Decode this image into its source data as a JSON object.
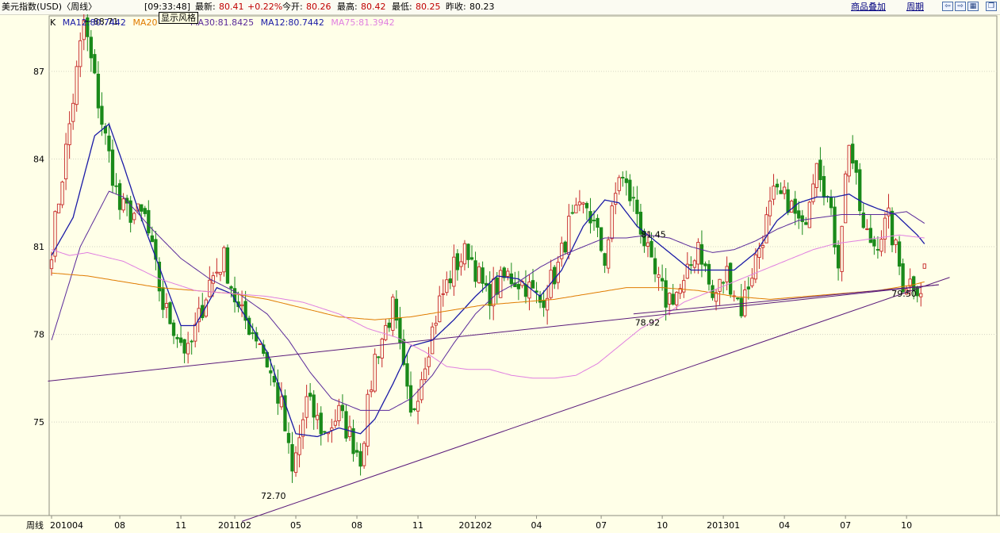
{
  "header": {
    "title": "美元指数(USD)〈周线〉",
    "time": "[09:33:48]",
    "last_label": "最新:",
    "last": "80.41",
    "change": "+0.22%",
    "open_label": "今开:",
    "open": "80.26",
    "high_label": "最高:",
    "high": "80.42",
    "low_label": "最低:",
    "low": "80.25",
    "prev_label": "昨收:",
    "prev": "80.23",
    "overlay_link": "商品叠加",
    "period_link": "周期",
    "tooltip": "显示风格"
  },
  "ma_legend": {
    "k": "K",
    "ma12_a": "MA12:80.7442",
    "ma20": "MA20",
    "ma30": "MA30:81.8425",
    "ma12_b": "MA12:80.7442",
    "ma75": "MA75:81.3942"
  },
  "colors": {
    "background": "#ffffe8",
    "up": "#c62828",
    "down": "#1a8a1a",
    "ma12": "#1a1aa6",
    "ma30": "#5a2a9a",
    "ma20": "#e07b00",
    "ma75": "#e07fe0",
    "trend": "#5a1a7a",
    "grid": "#d4d4c4"
  },
  "chart_data": {
    "type": "candlestick",
    "title": "美元指数(USD)〈周线〉",
    "period_label": "周线",
    "ylim": [
      71.8,
      88.9
    ],
    "yticks": [
      75,
      78,
      81,
      84,
      87
    ],
    "x_ticks": [
      {
        "i": 0,
        "label": "201004"
      },
      {
        "i": 19,
        "label": "08"
      },
      {
        "i": 36,
        "label": "11"
      },
      {
        "i": 51,
        "label": "201102"
      },
      {
        "i": 68,
        "label": "05"
      },
      {
        "i": 85,
        "label": "08"
      },
      {
        "i": 102,
        "label": "11"
      },
      {
        "i": 118,
        "label": "201202"
      },
      {
        "i": 135,
        "label": "04"
      },
      {
        "i": 153,
        "label": "07"
      },
      {
        "i": 170,
        "label": "10"
      },
      {
        "i": 187,
        "label": "201301"
      },
      {
        "i": 204,
        "label": "04"
      },
      {
        "i": 221,
        "label": "07"
      },
      {
        "i": 238,
        "label": "10"
      }
    ],
    "annotations": [
      {
        "i": 9,
        "price": 88.71,
        "text": "88.71",
        "pos": "right"
      },
      {
        "i": 67,
        "price": 72.7,
        "text": "72.70",
        "pos": "left-below"
      },
      {
        "i": 165,
        "price": 78.85,
        "text": "78.92",
        "pos": "below"
      },
      {
        "i": 168,
        "price": 81.2,
        "text": "81.45",
        "pos": "above"
      },
      {
        "i": 241,
        "price": 79.45,
        "text": "79.50",
        "pos": "left"
      }
    ],
    "waypoints": [
      [
        0,
        81
      ],
      [
        4,
        84.3
      ],
      [
        9,
        88.7
      ],
      [
        14,
        85.3
      ],
      [
        19,
        82.3
      ],
      [
        26,
        82
      ],
      [
        31,
        79
      ],
      [
        38,
        77.3
      ],
      [
        44,
        79.8
      ],
      [
        48,
        80.6
      ],
      [
        52,
        78.8
      ],
      [
        58,
        77.8
      ],
      [
        64,
        75.5
      ],
      [
        67,
        73.2
      ],
      [
        71,
        75.7
      ],
      [
        76,
        74.6
      ],
      [
        80,
        75.3
      ],
      [
        86,
        73.8
      ],
      [
        90,
        77.2
      ],
      [
        95,
        78.9
      ],
      [
        100,
        75.1
      ],
      [
        104,
        77.2
      ],
      [
        108,
        79.1
      ],
      [
        112,
        80.3
      ],
      [
        116,
        80.9
      ],
      [
        121,
        79.3
      ],
      [
        127,
        80
      ],
      [
        132,
        79.7
      ],
      [
        136,
        79.1
      ],
      [
        141,
        80.3
      ],
      [
        144,
        81.7
      ],
      [
        149,
        82.4
      ],
      [
        154,
        80.6
      ],
      [
        158,
        83.5
      ],
      [
        163,
        82.2
      ],
      [
        167,
        80.2
      ],
      [
        171,
        79.2
      ],
      [
        176,
        79.6
      ],
      [
        180,
        81.2
      ],
      [
        184,
        79.2
      ],
      [
        188,
        80.1
      ],
      [
        192,
        78.9
      ],
      [
        197,
        81
      ],
      [
        201,
        82.7
      ],
      [
        205,
        82.6
      ],
      [
        209,
        81.5
      ],
      [
        213,
        84.2
      ],
      [
        216,
        82.6
      ],
      [
        219,
        80.6
      ],
      [
        222,
        84.7
      ],
      [
        226,
        81.5
      ],
      [
        229,
        81.1
      ],
      [
        233,
        81.9
      ],
      [
        237,
        79.8
      ],
      [
        240,
        79.8
      ],
      [
        242,
        79.6
      ],
      [
        243,
        80.41
      ]
    ],
    "ma_lines": {
      "MA12": [
        [
          0,
          80.7
        ],
        [
          6,
          82
        ],
        [
          12,
          84.8
        ],
        [
          16,
          85.2
        ],
        [
          20,
          83.8
        ],
        [
          24,
          82.3
        ],
        [
          30,
          80.3
        ],
        [
          36,
          78.3
        ],
        [
          40,
          78.3
        ],
        [
          46,
          79.6
        ],
        [
          50,
          79.4
        ],
        [
          54,
          78.6
        ],
        [
          60,
          77.4
        ],
        [
          64,
          76
        ],
        [
          68,
          74.6
        ],
        [
          74,
          74.5
        ],
        [
          80,
          74.8
        ],
        [
          86,
          74.6
        ],
        [
          90,
          75.1
        ],
        [
          95,
          76.3
        ],
        [
          100,
          77.6
        ],
        [
          106,
          77.8
        ],
        [
          112,
          78.5
        ],
        [
          118,
          79.3
        ],
        [
          124,
          80
        ],
        [
          130,
          79.9
        ],
        [
          136,
          79.3
        ],
        [
          142,
          80.2
        ],
        [
          148,
          81.7
        ],
        [
          154,
          82.6
        ],
        [
          158,
          82.5
        ],
        [
          163,
          81.7
        ],
        [
          168,
          81.2
        ],
        [
          173,
          80.7
        ],
        [
          178,
          80.2
        ],
        [
          184,
          80.2
        ],
        [
          190,
          80.2
        ],
        [
          196,
          80.8
        ],
        [
          202,
          81.9
        ],
        [
          208,
          82.5
        ],
        [
          213,
          82.7
        ],
        [
          218,
          82.7
        ],
        [
          222,
          82.8
        ],
        [
          226,
          82.5
        ],
        [
          230,
          82.3
        ],
        [
          235,
          82.1
        ],
        [
          241,
          81.4
        ],
        [
          243,
          81.1
        ]
      ],
      "MA30": [
        [
          0,
          77.8
        ],
        [
          8,
          81
        ],
        [
          16,
          82.9
        ],
        [
          20,
          82.7
        ],
        [
          28,
          81.6
        ],
        [
          36,
          80.6
        ],
        [
          44,
          79.9
        ],
        [
          52,
          79.4
        ],
        [
          60,
          78.7
        ],
        [
          66,
          77.8
        ],
        [
          72,
          76.7
        ],
        [
          78,
          75.8
        ],
        [
          86,
          75.4
        ],
        [
          94,
          75.4
        ],
        [
          100,
          75.8
        ],
        [
          106,
          76.6
        ],
        [
          112,
          77.7
        ],
        [
          118,
          78.7
        ],
        [
          124,
          79.4
        ],
        [
          130,
          79.8
        ],
        [
          136,
          80.3
        ],
        [
          142,
          80.7
        ],
        [
          148,
          81
        ],
        [
          154,
          81.3
        ],
        [
          160,
          81.3
        ],
        [
          166,
          81.4
        ],
        [
          172,
          81.3
        ],
        [
          178,
          81
        ],
        [
          184,
          80.8
        ],
        [
          190,
          80.9
        ],
        [
          196,
          81.2
        ],
        [
          202,
          81.6
        ],
        [
          208,
          81.9
        ],
        [
          214,
          82
        ],
        [
          220,
          82.1
        ],
        [
          226,
          82.1
        ],
        [
          232,
          82.1
        ],
        [
          238,
          82.2
        ],
        [
          243,
          81.8
        ]
      ],
      "MA20": [
        [
          0,
          80.1
        ],
        [
          10,
          80
        ],
        [
          20,
          79.8
        ],
        [
          30,
          79.6
        ],
        [
          40,
          79.5
        ],
        [
          50,
          79.4
        ],
        [
          60,
          79.2
        ],
        [
          70,
          78.9
        ],
        [
          80,
          78.6
        ],
        [
          90,
          78.5
        ],
        [
          100,
          78.6
        ],
        [
          110,
          78.8
        ],
        [
          120,
          79
        ],
        [
          130,
          79.1
        ],
        [
          140,
          79.2
        ],
        [
          150,
          79.4
        ],
        [
          160,
          79.6
        ],
        [
          170,
          79.6
        ],
        [
          180,
          79.5
        ],
        [
          190,
          79.3
        ],
        [
          200,
          79.2
        ],
        [
          210,
          79.3
        ],
        [
          220,
          79.4
        ],
        [
          230,
          79.5
        ],
        [
          240,
          79.7
        ],
        [
          243,
          79.8
        ]
      ],
      "MA75": [
        [
          0,
          80.9
        ],
        [
          5,
          80.7
        ],
        [
          10,
          80.8
        ],
        [
          20,
          80.5
        ],
        [
          30,
          79.9
        ],
        [
          40,
          79.5
        ],
        [
          50,
          79.4
        ],
        [
          60,
          79.3
        ],
        [
          70,
          79.1
        ],
        [
          80,
          78.7
        ],
        [
          88,
          78.2
        ],
        [
          96,
          77.9
        ],
        [
          104,
          77.4
        ],
        [
          110,
          76.9
        ],
        [
          116,
          76.8
        ],
        [
          122,
          76.8
        ],
        [
          128,
          76.6
        ],
        [
          134,
          76.5
        ],
        [
          140,
          76.5
        ],
        [
          146,
          76.6
        ],
        [
          152,
          77
        ],
        [
          158,
          77.6
        ],
        [
          164,
          78.2
        ],
        [
          170,
          78.6
        ],
        [
          176,
          79.1
        ],
        [
          182,
          79.4
        ],
        [
          188,
          79.7
        ],
        [
          194,
          80
        ],
        [
          200,
          80.3
        ],
        [
          206,
          80.6
        ],
        [
          212,
          80.9
        ],
        [
          218,
          81.1
        ],
        [
          224,
          81.2
        ],
        [
          230,
          81.3
        ],
        [
          236,
          81.4
        ],
        [
          243,
          81.3
        ]
      ]
    },
    "trendlines": [
      {
        "from": [
          -1,
          76.4
        ],
        "to": [
          247,
          79.7
        ]
      },
      {
        "from": [
          53,
          71.6
        ],
        "to": [
          250,
          79.95
        ]
      },
      {
        "from": [
          162,
          78.7
        ],
        "to": [
          247,
          79.7
        ]
      }
    ],
    "ohlc_note": "weekly candles generated from waypoints; last bar O 80.26 H 80.42 L 80.25 C 80.41"
  }
}
